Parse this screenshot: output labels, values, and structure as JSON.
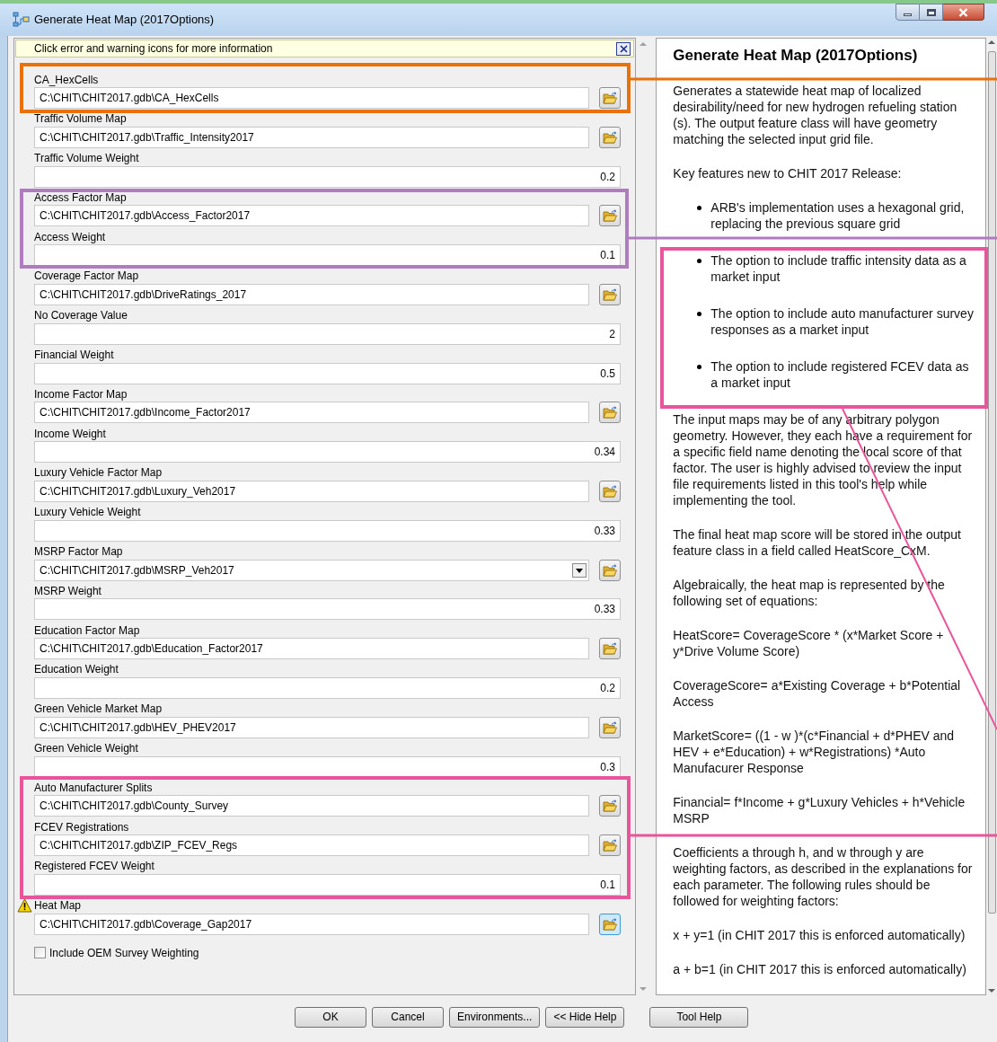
{
  "window": {
    "title": "Generate Heat Map (2017Options)"
  },
  "info_bar": {
    "text": "Click error and warning icons for more information"
  },
  "parameters": [
    {
      "kind": "path",
      "label": "CA_HexCells",
      "value": "C:\\CHIT\\CHIT2017.gdb\\CA_HexCells",
      "warning": false
    },
    {
      "kind": "path",
      "label": "Traffic Volume Map",
      "value": "C:\\CHIT\\CHIT2017.gdb\\Traffic_Intensity2017",
      "warning": false
    },
    {
      "kind": "number",
      "label": "Traffic Volume Weight",
      "value": "0.2",
      "warning": false
    },
    {
      "kind": "path",
      "label": "Access Factor Map",
      "value": "C:\\CHIT\\CHIT2017.gdb\\Access_Factor2017",
      "warning": false
    },
    {
      "kind": "number",
      "label": "Access Weight",
      "value": "0.1",
      "warning": false
    },
    {
      "kind": "path",
      "label": "Coverage Factor Map",
      "value": "C:\\CHIT\\CHIT2017.gdb\\DriveRatings_2017",
      "warning": false
    },
    {
      "kind": "number",
      "label": "No Coverage Value",
      "value": "2",
      "warning": false
    },
    {
      "kind": "number",
      "label": "Financial Weight",
      "value": "0.5",
      "warning": false
    },
    {
      "kind": "path",
      "label": "Income Factor Map",
      "value": "C:\\CHIT\\CHIT2017.gdb\\Income_Factor2017",
      "warning": false
    },
    {
      "kind": "number",
      "label": "Income Weight",
      "value": "0.34",
      "warning": false
    },
    {
      "kind": "path",
      "label": "Luxury Vehicle Factor Map",
      "value": "C:\\CHIT\\CHIT2017.gdb\\Luxury_Veh2017",
      "warning": false
    },
    {
      "kind": "number",
      "label": "Luxury Vehicle Weight",
      "value": "0.33",
      "warning": false
    },
    {
      "kind": "dropdown",
      "label": "MSRP Factor Map",
      "value": "C:\\CHIT\\CHIT2017.gdb\\MSRP_Veh2017",
      "warning": false
    },
    {
      "kind": "number",
      "label": "MSRP Weight",
      "value": "0.33",
      "warning": false
    },
    {
      "kind": "path",
      "label": "Education Factor Map",
      "value": "C:\\CHIT\\CHIT2017.gdb\\Education_Factor2017",
      "warning": false
    },
    {
      "kind": "number",
      "label": "Education Weight",
      "value": "0.2",
      "warning": false
    },
    {
      "kind": "path",
      "label": "Green Vehicle Market Map",
      "value": "C:\\CHIT\\CHIT2017.gdb\\HEV_PHEV2017",
      "warning": false
    },
    {
      "kind": "number",
      "label": "Green Vehicle Weight",
      "value": "0.3",
      "warning": false
    },
    {
      "kind": "path",
      "label": "Auto Manufacturer Splits",
      "value": "C:\\CHIT\\CHIT2017.gdb\\County_Survey",
      "warning": false
    },
    {
      "kind": "path",
      "label": "FCEV Registrations",
      "value": "C:\\CHIT\\CHIT2017.gdb\\ZIP_FCEV_Regs",
      "warning": false
    },
    {
      "kind": "number",
      "label": "Registered FCEV Weight",
      "value": "0.1",
      "warning": false
    },
    {
      "kind": "path",
      "label": "Heat Map",
      "value": "C:\\CHIT\\CHIT2017.gdb\\Coverage_Gap2017",
      "warning": true
    }
  ],
  "checkbox": {
    "label": "Include OEM Survey Weighting",
    "checked": false
  },
  "help": {
    "title": "Generate Heat Map (2017Options)",
    "blocks": [
      {
        "kind": "paragraph",
        "text": "Generates a statewide heat map of localized desirability/need for new hydrogen refueling station (s). The output feature class will have geometry matching the selected input grid file."
      },
      {
        "kind": "paragraph",
        "text": "Key features new to CHIT 2017 Release:"
      },
      {
        "kind": "bullet",
        "text": "ARB's implementation uses a hexagonal grid, replacing the previous square grid"
      },
      {
        "kind": "bullet",
        "text": "The option to include traffic intensity data as a market input"
      },
      {
        "kind": "bullet",
        "text": "The option to include auto manufacturer survey responses as a market input"
      },
      {
        "kind": "bullet",
        "text": "The option to include registered FCEV data as a market input"
      },
      {
        "kind": "paragraph",
        "text": "The input maps may be of any arbitrary polygon geometry. However, they each have a requirement for a specific field name denoting the local score of that factor. The user is highly advised to review the input file requirements listed in this tool's help while implementing the tool."
      },
      {
        "kind": "paragraph",
        "text": "The final heat map score will be stored in the output feature class in a field called HeatScore_CxM."
      },
      {
        "kind": "paragraph",
        "text": "Algebraically, the heat map is represented by the following set of equations:"
      },
      {
        "kind": "paragraph",
        "text": "HeatScore= CoverageScore * (x*Market Score + y*Drive Volume Score)"
      },
      {
        "kind": "paragraph",
        "text": "CoverageScore= a*Existing Coverage + b*Potential Access"
      },
      {
        "kind": "paragraph",
        "text": "MarketScore= ((1 - w )*(c*Financial + d*PHEV and HEV + e*Education) + w*Registrations) *Auto Manufacurer Response"
      },
      {
        "kind": "paragraph",
        "text": "Financial= f*Income + g*Luxury Vehicles + h*Vehicle MSRP"
      },
      {
        "kind": "paragraph",
        "text": "Coefficients a through h, and w through y are weighting factors, as described in the explanations for each parameter. The following rules should be followed for weighting factors:"
      },
      {
        "kind": "paragraph",
        "text": "x + y=1 (in CHIT 2017 this is enforced automatically)"
      },
      {
        "kind": "paragraph",
        "text": "a + b=1 (in CHIT 2017 this is enforced automatically)"
      }
    ]
  },
  "buttons": [
    "OK",
    "Cancel",
    "Environments...",
    "<< Hide Help"
  ],
  "tool_help_button": "Tool Help",
  "annotations": [
    {
      "color": "#e8710a"
    },
    {
      "color": "#b07cc0"
    },
    {
      "color": "#e8559a"
    },
    {
      "color": "#e8559a"
    }
  ]
}
